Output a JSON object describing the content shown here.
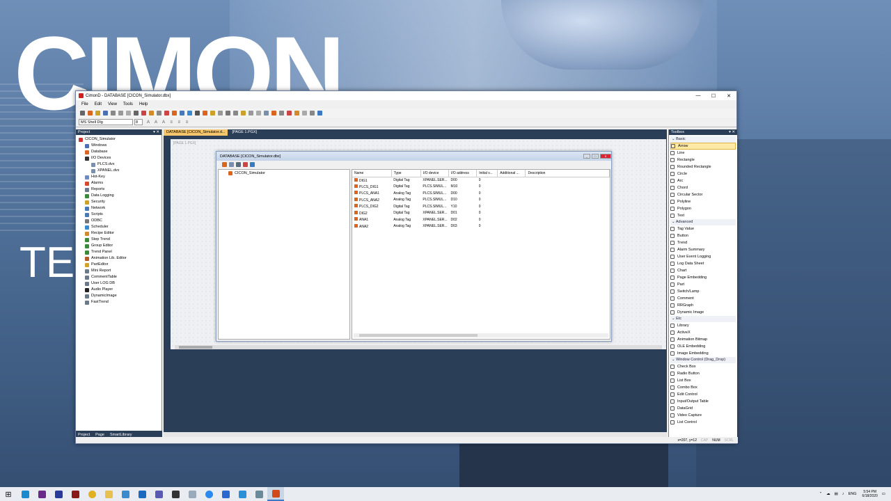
{
  "window": {
    "title": "CimonD - DATABASE [CICON_Simulator.dbx]",
    "controls": {
      "minimize": "—",
      "maximize": "☐",
      "close": "✕"
    }
  },
  "menu": [
    "File",
    "Edit",
    "View",
    "Tools",
    "Help"
  ],
  "format_bar": {
    "font": "MS Shell Dlg",
    "size": "8",
    "buttons": "A A A ≡ ≡ ≡"
  },
  "project_panel": {
    "title": "Project",
    "items": [
      {
        "label": "CICON_Simulator",
        "level": 0,
        "color": "#c33"
      },
      {
        "label": "Windows",
        "level": 1,
        "color": "#4a6fb5"
      },
      {
        "label": "Database",
        "level": 1,
        "color": "#d9651f"
      },
      {
        "label": "I/O Devices",
        "level": 1,
        "color": "#333"
      },
      {
        "label": "PLCS.dvx",
        "level": 2,
        "color": "#7a8fb0"
      },
      {
        "label": "XPANEL.dvx",
        "level": 2,
        "color": "#7a8fb0"
      },
      {
        "label": "Hot-Key",
        "level": 1,
        "color": "#6b8cc0"
      },
      {
        "label": "Alarms",
        "level": 1,
        "color": "#d94a2a"
      },
      {
        "label": "Reports",
        "level": 1,
        "color": "#6a7a8a"
      },
      {
        "label": "Data Logging",
        "level": 1,
        "color": "#3a8a3a"
      },
      {
        "label": "Security",
        "level": 1,
        "color": "#c9a227"
      },
      {
        "label": "Network",
        "level": 1,
        "color": "#4a7ab5"
      },
      {
        "label": "Scripts",
        "level": 1,
        "color": "#4a7ab5"
      },
      {
        "label": "ODBC",
        "level": 1,
        "color": "#777"
      },
      {
        "label": "Scheduler",
        "level": 1,
        "color": "#3a8ad0"
      },
      {
        "label": "Recipe Editor",
        "level": 1,
        "color": "#d28a2a"
      },
      {
        "label": "Step Trend",
        "level": 1,
        "color": "#3a8a3a"
      },
      {
        "label": "Group Editor",
        "level": 1,
        "color": "#3a8a3a"
      },
      {
        "label": "Trend Panel",
        "level": 1,
        "color": "#3a8a3a"
      },
      {
        "label": "Animation Lib. Editor",
        "level": 1,
        "color": "#b55a2a"
      },
      {
        "label": "PartEditor",
        "level": 1,
        "color": "#d2a22a"
      },
      {
        "label": "Mini Report",
        "level": 1,
        "color": "#6a7a8a"
      },
      {
        "label": "CommentTable",
        "level": 1,
        "color": "#6a7a8a"
      },
      {
        "label": "User LOG DB",
        "level": 1,
        "color": "#6a7a8a"
      },
      {
        "label": "Audio Player",
        "level": 1,
        "color": "#222"
      },
      {
        "label": "DynamicImage",
        "level": 1,
        "color": "#6a7a8a"
      },
      {
        "label": "FastTrend",
        "level": 1,
        "color": "#6a7a8a"
      }
    ],
    "footer": {
      "project": "Project",
      "page": "Page",
      "smartlib": "SmartLibrary"
    }
  },
  "tabs": [
    {
      "label": "DATABASE [CICON_Simulator.d...",
      "active": true
    },
    {
      "label": "[PAGE 1.PGX]",
      "active": false
    }
  ],
  "canvas": {
    "page_label": "[PAGE 1.PGX]"
  },
  "db_window": {
    "title": "DATABASE [CICON_Simulator.dbx]",
    "root": "CICON_Simulator",
    "columns": [
      "Name",
      "Type",
      "I/O device",
      "I/O address",
      "Initial v...",
      "Additional ...",
      "Description"
    ],
    "rows": [
      [
        "DIG1",
        "Digital Tag",
        "XPANEL.SER...",
        "D00",
        "0",
        "",
        ""
      ],
      [
        "PLCS_DIG1",
        "Digital Tag",
        "PLCS.SIMUL...",
        "M10",
        "0",
        "",
        ""
      ],
      [
        "PLCS_ANA1",
        "Analog Tag",
        "PLCS.SIMUL...",
        "D00",
        "0",
        "",
        ""
      ],
      [
        "PLCS_ANA2",
        "Analog Tag",
        "PLCS.SIMUL...",
        "D10",
        "0",
        "",
        ""
      ],
      [
        "PLCS_DIG2",
        "Digital Tag",
        "PLCS.SIMUL...",
        "Y10",
        "0",
        "",
        ""
      ],
      [
        "DIG2",
        "Digital Tag",
        "XPANEL.SER...",
        "D01",
        "0",
        "",
        ""
      ],
      [
        "ANA1",
        "Analog Tag",
        "XPANEL.SER...",
        "D02",
        "0",
        "",
        ""
      ],
      [
        "ANA2",
        "Analog Tag",
        "XPANEL.SER...",
        "D03",
        "0",
        "",
        ""
      ]
    ]
  },
  "toolbox": {
    "title": "Toolbox",
    "groups": [
      {
        "name": "Basic",
        "items": [
          "Arrow",
          "Line",
          "Rectangle",
          "Rounded Rectangle",
          "Circle",
          "Arc",
          "Chord",
          "Circular Sector",
          "Polyline",
          "Polygon",
          "Text"
        ]
      },
      {
        "name": "Advanced",
        "items": [
          "Tag Value",
          "Button",
          "Trend",
          "Alarm Summary",
          "User Event Logging",
          "Log Data Sheet",
          "Chart",
          "Page Embedding",
          "Part",
          "Switch/Lamp",
          "Comment",
          "RRGraph",
          "Dynamic Image"
        ]
      },
      {
        "name": "Etc",
        "items": [
          "Library",
          "ActiveX",
          "Animation Bitmap",
          "OLE Embedding",
          "Image Embedding"
        ]
      },
      {
        "name": "Window Control (Drag_Drop)",
        "items": [
          "Check Box",
          "Radio Button",
          "List Box",
          "Combo Box",
          "Edit Control",
          "Input/Output Table",
          "DataGrid",
          "Video Capture",
          "List Control"
        ]
      }
    ]
  },
  "status": {
    "coords": "x=207, y=12",
    "cap": "CAP",
    "num": "NUM",
    "scrl": "SCRL"
  },
  "taskbar": {
    "lang": "ENG",
    "time": "5:54 PM",
    "date": "6/18/2020"
  },
  "background": {
    "logo_text": "CIMON",
    "side_text": "TE"
  }
}
